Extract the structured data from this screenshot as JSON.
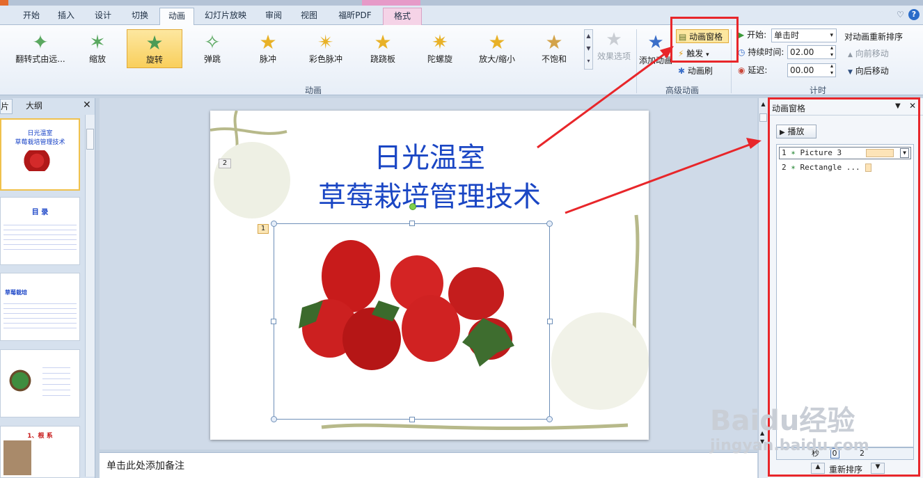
{
  "tabs": [
    {
      "label": "开始"
    },
    {
      "label": "插入"
    },
    {
      "label": "设计"
    },
    {
      "label": "切换"
    },
    {
      "label": "动画"
    },
    {
      "label": "幻灯片放映"
    },
    {
      "label": "审阅"
    },
    {
      "label": "视图"
    },
    {
      "label": "福昕PDF"
    },
    {
      "label": "格式"
    }
  ],
  "ribbon": {
    "animations": [
      {
        "label": "翻转式由远...",
        "icon": "flip-star-icon"
      },
      {
        "label": "缩放",
        "icon": "zoom-star-icon"
      },
      {
        "label": "旋转",
        "icon": "spin-star-icon"
      },
      {
        "label": "弹跳",
        "icon": "bounce-star-icon"
      },
      {
        "label": "脉冲",
        "icon": "pulse-star-icon"
      },
      {
        "label": "彩色脉冲",
        "icon": "color-pulse-star-icon"
      },
      {
        "label": "跷跷板",
        "icon": "teeter-star-icon"
      },
      {
        "label": "陀螺旋",
        "icon": "spin-top-star-icon"
      },
      {
        "label": "放大/缩小",
        "icon": "grow-shrink-star-icon"
      },
      {
        "label": "不饱和",
        "icon": "desaturate-star-icon"
      }
    ],
    "effect_options": "效果选项",
    "group_animation": "动画",
    "add_animation": "添加动画",
    "animation_pane_btn": "动画窗格",
    "trigger": "触发",
    "animation_painter": "动画刷",
    "group_advanced": "高级动画",
    "start_label": "开始:",
    "start_value": "单击时",
    "duration_label": "持续时间:",
    "duration_value": "02.00",
    "delay_label": "延迟:",
    "delay_value": "00.00",
    "group_timing": "计时",
    "reorder_title": "对动画重新排序",
    "move_earlier": "向前移动",
    "move_later": "向后移动"
  },
  "left_panel": {
    "tab_slides": "片",
    "tab_outline": "大纲",
    "thumb1_title1": "日光温室",
    "thumb1_title2": "草莓栽培管理技术",
    "thumb2_title": "目  录",
    "thumb3_title": "草莓栽培",
    "thumb5_title": "1、根 系"
  },
  "slide": {
    "number_badge": "2",
    "title_line1": "日光温室",
    "title_line2": "草莓栽培管理技术",
    "anim_tag": "1"
  },
  "notes_placeholder": "单击此处添加备注",
  "anim_pane": {
    "title": "动画窗格",
    "play": "播放",
    "items": [
      {
        "index": "1",
        "name": "Picture 3"
      },
      {
        "index": "2",
        "name": "Rectangle ..."
      }
    ],
    "seconds": "秒",
    "timeline_0": "0",
    "timeline_2": "2",
    "reorder": "重新排序"
  },
  "watermark": {
    "text": "Baidu经验",
    "url": "jingyan.baidu.com"
  }
}
